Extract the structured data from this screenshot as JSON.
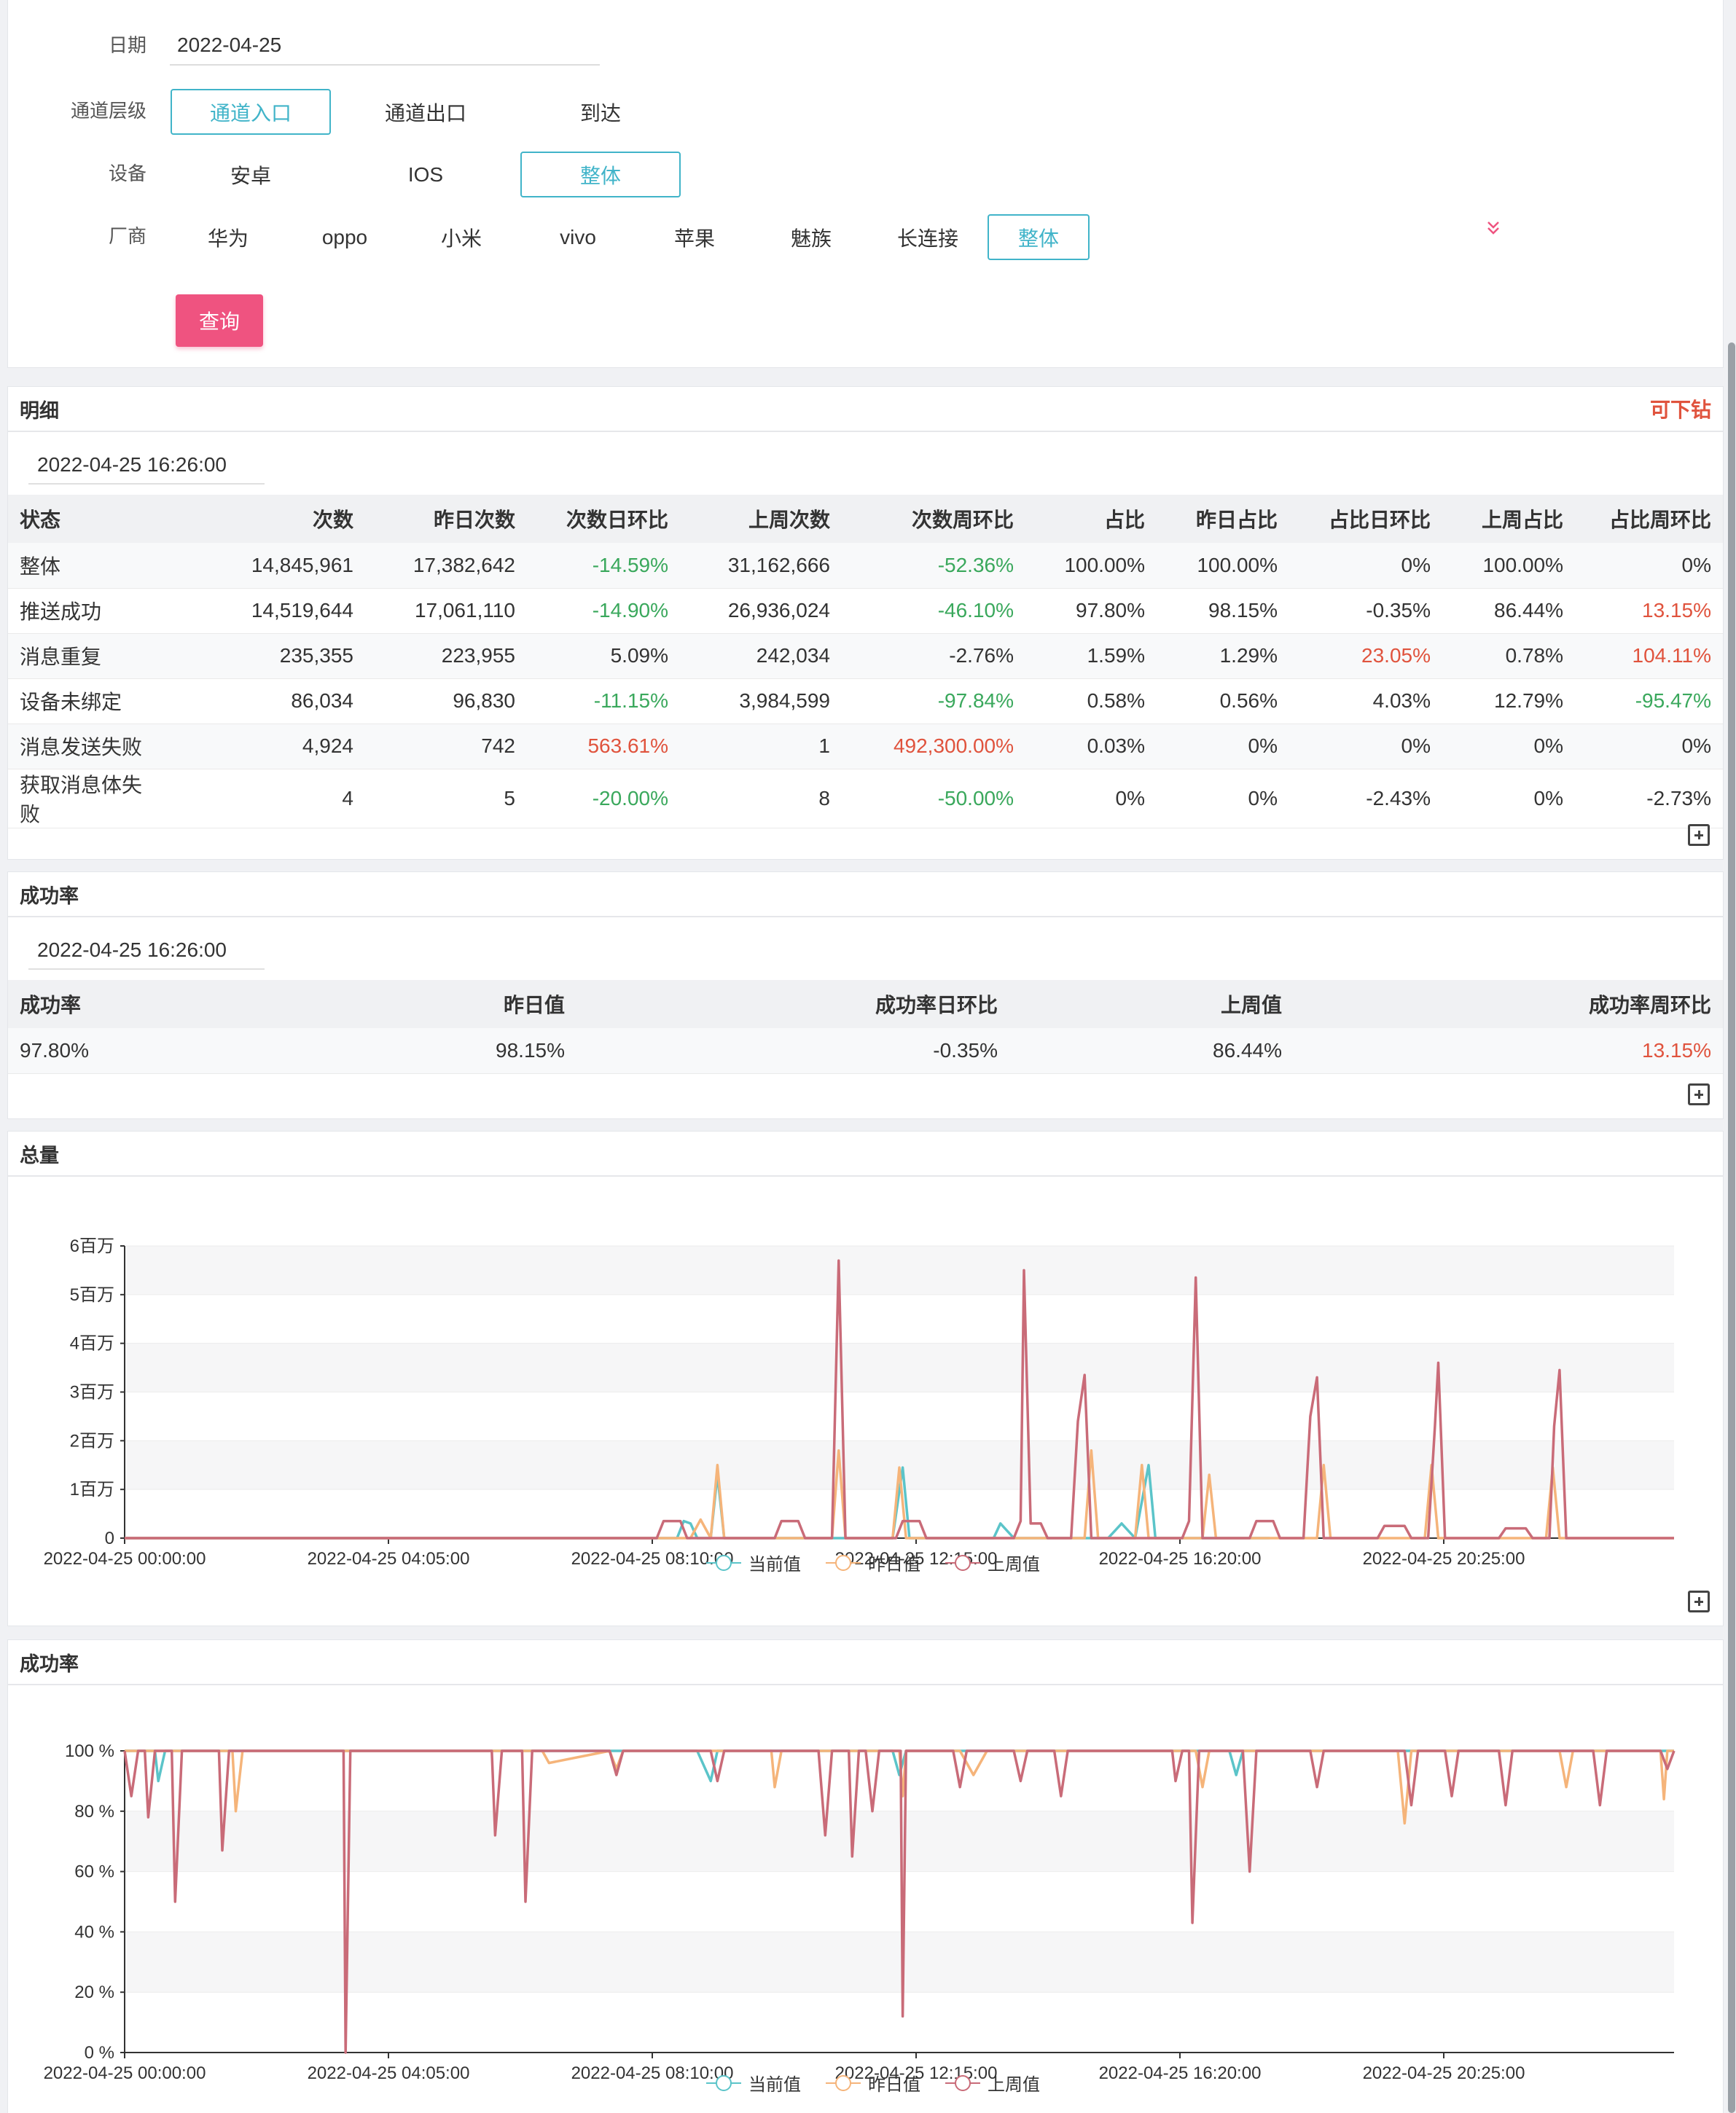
{
  "filters": {
    "date_label": "日期",
    "date_value": "2022-04-25",
    "channel_label": "通道层级",
    "channel_options": [
      "通道入口",
      "通道出口",
      "到达"
    ],
    "device_label": "设备",
    "device_options": [
      "安卓",
      "IOS",
      "整体"
    ],
    "vendor_label": "厂商",
    "vendor_options": [
      "华为",
      "oppo",
      "小米",
      "vivo",
      "苹果",
      "魅族",
      "长连接",
      "整体"
    ],
    "query_button": "查询",
    "expand_icon": "double-chevron-down-icon"
  },
  "detail": {
    "title": "明细",
    "drill_link": "可下钻",
    "timestamp": "2022-04-25 16:26:00",
    "columns": [
      "状态",
      "次数",
      "昨日次数",
      "次数日环比",
      "上周次数",
      "次数周环比",
      "占比",
      "昨日占比",
      "占比日环比",
      "上周占比",
      "占比周环比"
    ],
    "rows": [
      [
        "整体",
        "14,845,961",
        "17,382,642",
        "-14.59%",
        "31,162,666",
        "-52.36%",
        "100.00%",
        "100.00%",
        "0%",
        "100.00%",
        "0%"
      ],
      [
        "推送成功",
        "14,519,644",
        "17,061,110",
        "-14.90%",
        "26,936,024",
        "-46.10%",
        "97.80%",
        "98.15%",
        "-0.35%",
        "86.44%",
        "13.15%"
      ],
      [
        "消息重复",
        "235,355",
        "223,955",
        "5.09%",
        "242,034",
        "-2.76%",
        "1.59%",
        "1.29%",
        "23.05%",
        "0.78%",
        "104.11%"
      ],
      [
        "设备未绑定",
        "86,034",
        "96,830",
        "-11.15%",
        "3,984,599",
        "-97.84%",
        "0.58%",
        "0.56%",
        "4.03%",
        "12.79%",
        "-95.47%"
      ],
      [
        "消息发送失败",
        "4,924",
        "742",
        "563.61%",
        "1",
        "492,300.00%",
        "0.03%",
        "0%",
        "0%",
        "0%",
        "0%"
      ],
      [
        "获取消息体失败",
        "4",
        "5",
        "-20.00%",
        "8",
        "-50.00%",
        "0%",
        "0%",
        "-2.43%",
        "0%",
        "-2.73%"
      ]
    ]
  },
  "success": {
    "title": "成功率",
    "timestamp": "2022-04-25 16:26:00",
    "columns": [
      "成功率",
      "昨日值",
      "成功率日环比",
      "上周值",
      "成功率周环比"
    ],
    "row": [
      "97.80%",
      "98.15%",
      "-0.35%",
      "86.44%",
      "13.15%"
    ]
  },
  "colors": {
    "current": "#5bc4c9",
    "yesterday": "#f5b47a",
    "lastweek": "#c96b78",
    "accent": "#41b4c9",
    "button": "#ef5380",
    "up": "#e0533d",
    "down": "#3aa85c"
  },
  "chart_data": [
    {
      "type": "line",
      "title": "总量",
      "x_tick_labels": [
        "2022-04-25 00:00:00",
        "2022-04-25 04:05:00",
        "2022-04-25 08:10:00",
        "2022-04-25 12:15:00",
        "2022-04-25 16:20:00",
        "2022-04-25 20:25:00"
      ],
      "y_tick_labels": [
        "0",
        "1百万",
        "2百万",
        "3百万",
        "4百万",
        "5百万",
        "6百万"
      ],
      "ylim": [
        0,
        6000000
      ],
      "x_minutes_range": [
        0,
        1400
      ],
      "series_names": [
        "当前值",
        "昨日值",
        "上周值"
      ],
      "series": [
        {
          "name": "当前值",
          "points": [
            [
              0,
              0
            ],
            [
              820,
              0
            ],
            [
              830,
              350000
            ],
            [
              840,
              300000
            ],
            [
              850,
              0
            ],
            [
              870,
              0
            ],
            [
              880,
              1300000
            ],
            [
              890,
              0
            ],
            [
              1140,
              0
            ],
            [
              1155,
              1450000
            ],
            [
              1165,
              0
            ],
            [
              1290,
              0
            ],
            [
              1300,
              300000
            ],
            [
              1320,
              0
            ],
            [
              1460,
              0
            ],
            [
              1480,
              300000
            ],
            [
              1500,
              0
            ],
            [
              1520,
              1500000
            ],
            [
              1530,
              0
            ],
            [
              1700,
              0
            ]
          ]
        },
        {
          "name": "昨日值",
          "points": [
            [
              0,
              0
            ],
            [
              840,
              0
            ],
            [
              855,
              380000
            ],
            [
              870,
              0
            ],
            [
              880,
              1500000
            ],
            [
              890,
              0
            ],
            [
              1050,
              0
            ],
            [
              1060,
              1800000
            ],
            [
              1070,
              0
            ],
            [
              1140,
              0
            ],
            [
              1150,
              1450000
            ],
            [
              1160,
              0
            ],
            [
              1425,
              0
            ],
            [
              1435,
              1800000
            ],
            [
              1445,
              0
            ],
            [
              1500,
              0
            ],
            [
              1510,
              1500000
            ],
            [
              1520,
              0
            ],
            [
              1600,
              0
            ],
            [
              1610,
              1300000
            ],
            [
              1620,
              0
            ],
            [
              1770,
              0
            ],
            [
              1780,
              1500000
            ],
            [
              1790,
              0
            ],
            [
              1930,
              0
            ],
            [
              1940,
              1500000
            ],
            [
              1950,
              0
            ],
            [
              2110,
              0
            ],
            [
              2120,
              1450000
            ],
            [
              2130,
              0
            ],
            [
              2300,
              0
            ]
          ]
        },
        {
          "name": "上周值",
          "points": [
            [
              0,
              0
            ],
            [
              790,
              0
            ],
            [
              800,
              350000
            ],
            [
              825,
              350000
            ],
            [
              835,
              0
            ],
            [
              965,
              0
            ],
            [
              975,
              350000
            ],
            [
              1000,
              350000
            ],
            [
              1010,
              0
            ],
            [
              1050,
              0
            ],
            [
              1060,
              5700000
            ],
            [
              1070,
              0
            ],
            [
              1145,
              0
            ],
            [
              1155,
              350000
            ],
            [
              1180,
              350000
            ],
            [
              1190,
              0
            ],
            [
              1320,
              0
            ],
            [
              1330,
              350000
            ],
            [
              1335,
              5500000
            ],
            [
              1345,
              300000
            ],
            [
              1360,
              300000
            ],
            [
              1370,
              0
            ],
            [
              1405,
              0
            ],
            [
              1415,
              2400000
            ],
            [
              1425,
              3350000
            ],
            [
              1435,
              0
            ],
            [
              1570,
              0
            ],
            [
              1580,
              350000
            ],
            [
              1590,
              5350000
            ],
            [
              1600,
              0
            ],
            [
              1670,
              0
            ],
            [
              1680,
              350000
            ],
            [
              1705,
              350000
            ],
            [
              1715,
              0
            ],
            [
              1750,
              0
            ],
            [
              1760,
              2500000
            ],
            [
              1770,
              3300000
            ],
            [
              1780,
              0
            ],
            [
              1860,
              0
            ],
            [
              1870,
              250000
            ],
            [
              1900,
              250000
            ],
            [
              1910,
              0
            ],
            [
              1935,
              0
            ],
            [
              1945,
              2300000
            ],
            [
              1950,
              3600000
            ],
            [
              1960,
              0
            ],
            [
              2040,
              0
            ],
            [
              2050,
              200000
            ],
            [
              2080,
              200000
            ],
            [
              2090,
              0
            ],
            [
              2115,
              0
            ],
            [
              2122,
              2300000
            ],
            [
              2130,
              3450000
            ],
            [
              2140,
              0
            ],
            [
              2300,
              0
            ]
          ]
        }
      ]
    },
    {
      "type": "line",
      "title": "成功率",
      "x_tick_labels": [
        "2022-04-25 00:00:00",
        "2022-04-25 04:05:00",
        "2022-04-25 08:10:00",
        "2022-04-25 12:15:00",
        "2022-04-25 16:20:00",
        "2022-04-25 20:25:00"
      ],
      "y_tick_labels": [
        "0 %",
        "20 %",
        "40 %",
        "60 %",
        "80 %",
        "100 %"
      ],
      "ylim": [
        0,
        100
      ],
      "series_names": [
        "当前值",
        "昨日值",
        "上周值"
      ],
      "series": [
        {
          "name": "当前值",
          "points": [
            [
              0,
              100
            ],
            [
              45,
              100
            ],
            [
              50,
              90
            ],
            [
              60,
              100
            ],
            [
              850,
              100
            ],
            [
              870,
              90
            ],
            [
              880,
              100
            ],
            [
              1140,
              100
            ],
            [
              1150,
              92
            ],
            [
              1160,
              100
            ],
            [
              1640,
              100
            ],
            [
              1650,
              92
            ],
            [
              1660,
              100
            ],
            [
              2300,
              100
            ]
          ]
        },
        {
          "name": "昨日值",
          "points": [
            [
              0,
              100
            ],
            [
              160,
              100
            ],
            [
              165,
              80
            ],
            [
              175,
              100
            ],
            [
              620,
              100
            ],
            [
              630,
              96
            ],
            [
              720,
              100
            ],
            [
              730,
              94
            ],
            [
              740,
              100
            ],
            [
              960,
              100
            ],
            [
              965,
              88
            ],
            [
              975,
              100
            ],
            [
              1150,
              100
            ],
            [
              1155,
              85
            ],
            [
              1160,
              100
            ],
            [
              1240,
              100
            ],
            [
              1260,
              92
            ],
            [
              1280,
              100
            ],
            [
              1590,
              100
            ],
            [
              1600,
              88
            ],
            [
              1610,
              100
            ],
            [
              1890,
              100
            ],
            [
              1900,
              76
            ],
            [
              1910,
              100
            ],
            [
              2130,
              100
            ],
            [
              2140,
              88
            ],
            [
              2150,
              100
            ],
            [
              2280,
              100
            ],
            [
              2285,
              84
            ],
            [
              2290,
              100
            ],
            [
              2300,
              100
            ]
          ]
        },
        {
          "name": "上周值",
          "points": [
            [
              0,
              100
            ],
            [
              10,
              85
            ],
            [
              20,
              100
            ],
            [
              30,
              100
            ],
            [
              35,
              78
            ],
            [
              45,
              100
            ],
            [
              70,
              100
            ],
            [
              75,
              50
            ],
            [
              85,
              100
            ],
            [
              140,
              100
            ],
            [
              145,
              67
            ],
            [
              155,
              100
            ],
            [
              325,
              100
            ],
            [
              328,
              0
            ],
            [
              335,
              100
            ],
            [
              545,
              100
            ],
            [
              550,
              72
            ],
            [
              560,
              100
            ],
            [
              590,
              100
            ],
            [
              595,
              50
            ],
            [
              605,
              100
            ],
            [
              720,
              100
            ],
            [
              730,
              92
            ],
            [
              740,
              100
            ],
            [
              870,
              100
            ],
            [
              880,
              90
            ],
            [
              890,
              100
            ],
            [
              1030,
              100
            ],
            [
              1040,
              72
            ],
            [
              1050,
              100
            ],
            [
              1075,
              100
            ],
            [
              1080,
              65
            ],
            [
              1090,
              100
            ],
            [
              1100,
              100
            ],
            [
              1110,
              80
            ],
            [
              1120,
              100
            ],
            [
              1152,
              100
            ],
            [
              1155,
              12
            ],
            [
              1160,
              100
            ],
            [
              1230,
              100
            ],
            [
              1240,
              88
            ],
            [
              1250,
              100
            ],
            [
              1320,
              100
            ],
            [
              1330,
              90
            ],
            [
              1340,
              100
            ],
            [
              1380,
              100
            ],
            [
              1390,
              85
            ],
            [
              1400,
              100
            ],
            [
              1555,
              100
            ],
            [
              1560,
              90
            ],
            [
              1570,
              100
            ],
            [
              1580,
              100
            ],
            [
              1585,
              43
            ],
            [
              1595,
              100
            ],
            [
              1660,
              100
            ],
            [
              1670,
              60
            ],
            [
              1680,
              100
            ],
            [
              1760,
              100
            ],
            [
              1770,
              88
            ],
            [
              1780,
              100
            ],
            [
              1900,
              100
            ],
            [
              1910,
              82
            ],
            [
              1920,
              100
            ],
            [
              1960,
              100
            ],
            [
              1970,
              85
            ],
            [
              1980,
              100
            ],
            [
              2040,
              100
            ],
            [
              2050,
              82
            ],
            [
              2060,
              100
            ],
            [
              2180,
              100
            ],
            [
              2190,
              82
            ],
            [
              2200,
              100
            ],
            [
              2280,
              100
            ],
            [
              2290,
              94
            ],
            [
              2300,
              100
            ]
          ]
        }
      ]
    }
  ]
}
